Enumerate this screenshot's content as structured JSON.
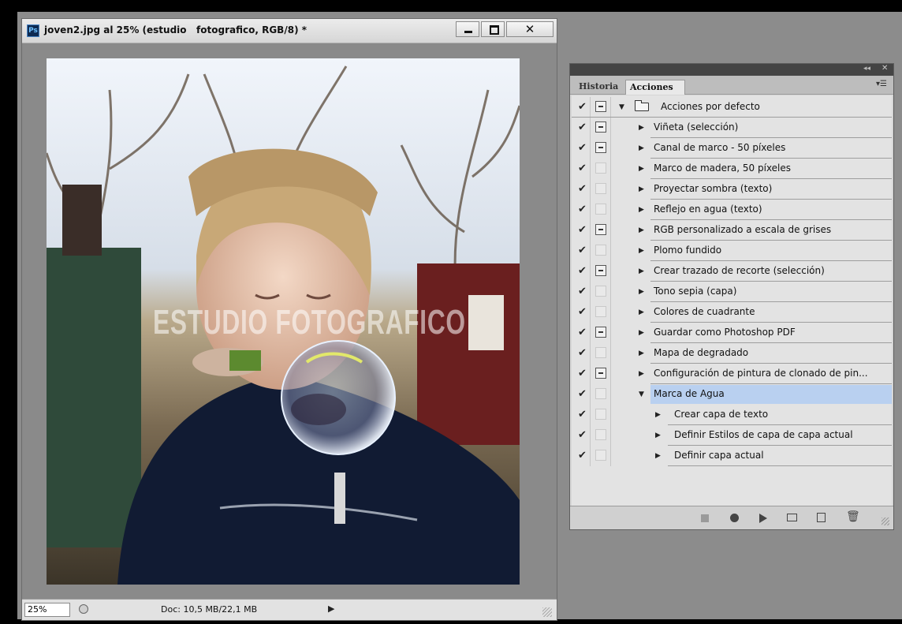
{
  "document": {
    "title": "joven2.jpg al 25% (estudio   fotografico, RGB/8) *",
    "app_icon": "Ps",
    "watermark": "ESTUDIO FOTOGRAFICO",
    "zoom": "25%",
    "doc_size": "Doc: 10,5 MB/22,1 MB",
    "status_arrow": "▶",
    "close_glyph": "✕"
  },
  "panel": {
    "collapse": "◂◂",
    "close": "✕",
    "menu": "▾☰",
    "tabs": [
      {
        "label": "Historia",
        "active": false
      },
      {
        "label": "Acciones",
        "active": true
      }
    ],
    "check_glyph": "✔",
    "folder_set": {
      "label": "Acciones por defecto",
      "expanded": true,
      "dialog": true
    },
    "actions": [
      {
        "label": "Viñeta (selección)",
        "dialog": true
      },
      {
        "label": "Canal de marco - 50 píxeles",
        "dialog": true
      },
      {
        "label": "Marco de madera, 50 píxeles",
        "dialog": false
      },
      {
        "label": "Proyectar sombra (texto)",
        "dialog": false
      },
      {
        "label": "Reflejo en agua (texto)",
        "dialog": false
      },
      {
        "label": "RGB personalizado a escala de grises",
        "dialog": true
      },
      {
        "label": "Plomo fundido",
        "dialog": false
      },
      {
        "label": "Crear trazado de recorte (selección)",
        "dialog": true
      },
      {
        "label": "Tono sepia (capa)",
        "dialog": false
      },
      {
        "label": "Colores de cuadrante",
        "dialog": false
      },
      {
        "label": "Guardar como Photoshop PDF",
        "dialog": true
      },
      {
        "label": "Mapa de degradado",
        "dialog": false
      },
      {
        "label": "Configuración de pintura de clonado de pin...",
        "dialog": true
      },
      {
        "label": "Marca de Agua",
        "dialog": false,
        "expanded": true,
        "selected": true
      }
    ],
    "steps": [
      {
        "label": "Crear capa de texto",
        "dialog": false
      },
      {
        "label": "Definir Estilos de capa de capa actual",
        "dialog": false
      },
      {
        "label": "Definir capa actual",
        "dialog": false
      }
    ],
    "bottom_icons": [
      "stop-icon",
      "record-icon",
      "play-icon",
      "new-set-icon",
      "new-action-icon",
      "trash-icon"
    ],
    "trash_glyph": "🗑"
  },
  "colors": {
    "selection": "#b9d0f0",
    "photoshop_blue": "#0d2a52"
  }
}
